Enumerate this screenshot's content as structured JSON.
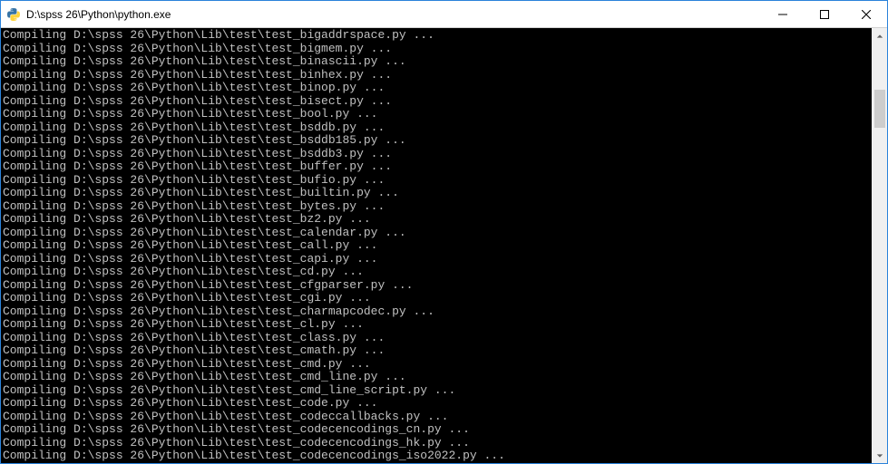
{
  "window": {
    "title": "D:\\spss 26\\Python\\python.exe"
  },
  "console": {
    "prefix": "Compiling ",
    "base_path": "D:\\spss 26\\Python\\Lib\\test\\",
    "suffix": " ...",
    "files": [
      "test_bigaddrspace.py",
      "test_bigmem.py",
      "test_binascii.py",
      "test_binhex.py",
      "test_binop.py",
      "test_bisect.py",
      "test_bool.py",
      "test_bsddb.py",
      "test_bsddb185.py",
      "test_bsddb3.py",
      "test_buffer.py",
      "test_bufio.py",
      "test_builtin.py",
      "test_bytes.py",
      "test_bz2.py",
      "test_calendar.py",
      "test_call.py",
      "test_capi.py",
      "test_cd.py",
      "test_cfgparser.py",
      "test_cgi.py",
      "test_charmapcodec.py",
      "test_cl.py",
      "test_class.py",
      "test_cmath.py",
      "test_cmd.py",
      "test_cmd_line.py",
      "test_cmd_line_script.py",
      "test_code.py",
      "test_codeccallbacks.py",
      "test_codecencodings_cn.py",
      "test_codecencodings_hk.py",
      "test_codecencodings_iso2022.py"
    ]
  }
}
